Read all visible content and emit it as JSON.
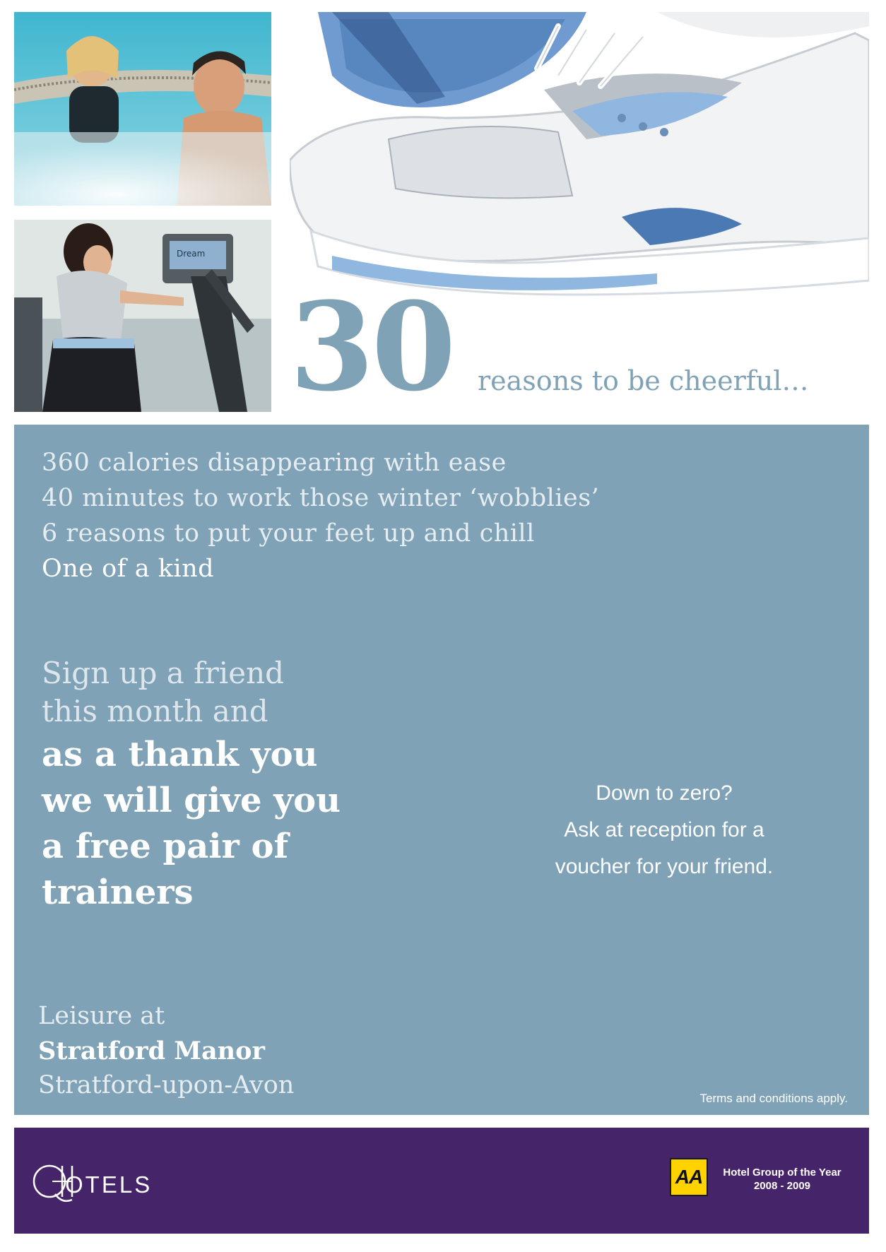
{
  "headline": {
    "number": "30",
    "tagline": "reasons to be cheerful…"
  },
  "reasons": [
    "360 calories disappearing with ease",
    "40 minutes to work those winter ‘wobblies’",
    "6 reasons to put your feet up and chill",
    "One of a kind"
  ],
  "offer": {
    "lines": [
      "Sign up a friend",
      "this month and",
      "as a thank you",
      "we will give you",
      "a free pair of",
      "trainers"
    ]
  },
  "side_note": {
    "lines": [
      "Down to zero?",
      "Ask at reception for a",
      "voucher for your friend."
    ]
  },
  "venue": {
    "lines": [
      "Leisure at",
      "Stratford Manor",
      "Stratford-upon-Avon"
    ]
  },
  "terms": "Terms and conditions apply.",
  "footer": {
    "brand": "OTELS",
    "brand_logo_letters": "QH",
    "aa_badge": "AA",
    "award_lines": [
      "Hotel Group of the Year",
      "2008 - 2009"
    ],
    "colors": {
      "footer_bg": "#46246a",
      "panel_bg": "#7fa2b6",
      "aa_yellow": "#ffd200"
    }
  },
  "photos": {
    "hottub": "hot-tub-couple-photo",
    "gym": "gym-cross-trainer-photo",
    "shoe": "running-trainer-photo",
    "machine_screen_text": "Dream"
  }
}
